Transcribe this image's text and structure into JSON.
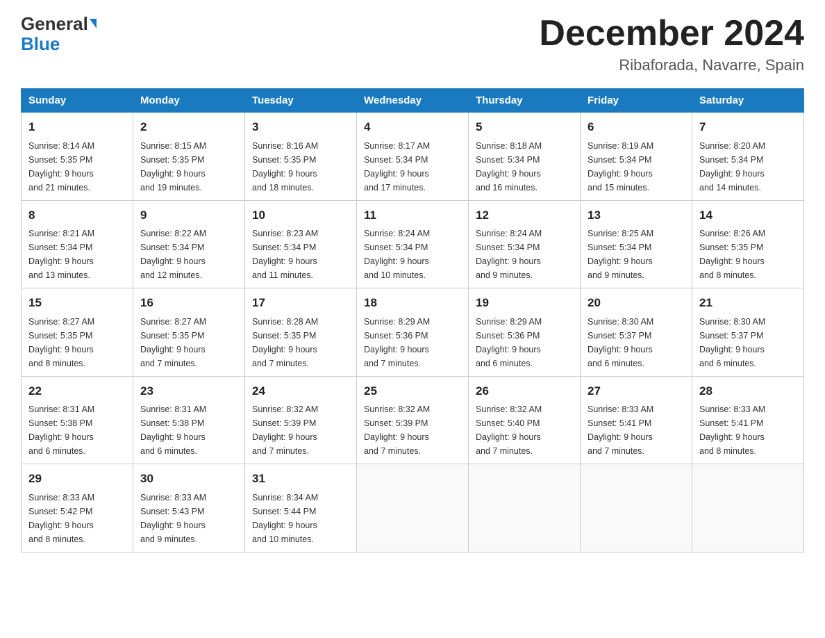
{
  "header": {
    "logo_general": "General",
    "logo_blue": "Blue",
    "month_title": "December 2024",
    "location": "Ribaforada, Navarre, Spain"
  },
  "days_of_week": [
    "Sunday",
    "Monday",
    "Tuesday",
    "Wednesday",
    "Thursday",
    "Friday",
    "Saturday"
  ],
  "weeks": [
    [
      {
        "num": "1",
        "info": "Sunrise: 8:14 AM\nSunset: 5:35 PM\nDaylight: 9 hours\nand 21 minutes."
      },
      {
        "num": "2",
        "info": "Sunrise: 8:15 AM\nSunset: 5:35 PM\nDaylight: 9 hours\nand 19 minutes."
      },
      {
        "num": "3",
        "info": "Sunrise: 8:16 AM\nSunset: 5:35 PM\nDaylight: 9 hours\nand 18 minutes."
      },
      {
        "num": "4",
        "info": "Sunrise: 8:17 AM\nSunset: 5:34 PM\nDaylight: 9 hours\nand 17 minutes."
      },
      {
        "num": "5",
        "info": "Sunrise: 8:18 AM\nSunset: 5:34 PM\nDaylight: 9 hours\nand 16 minutes."
      },
      {
        "num": "6",
        "info": "Sunrise: 8:19 AM\nSunset: 5:34 PM\nDaylight: 9 hours\nand 15 minutes."
      },
      {
        "num": "7",
        "info": "Sunrise: 8:20 AM\nSunset: 5:34 PM\nDaylight: 9 hours\nand 14 minutes."
      }
    ],
    [
      {
        "num": "8",
        "info": "Sunrise: 8:21 AM\nSunset: 5:34 PM\nDaylight: 9 hours\nand 13 minutes."
      },
      {
        "num": "9",
        "info": "Sunrise: 8:22 AM\nSunset: 5:34 PM\nDaylight: 9 hours\nand 12 minutes."
      },
      {
        "num": "10",
        "info": "Sunrise: 8:23 AM\nSunset: 5:34 PM\nDaylight: 9 hours\nand 11 minutes."
      },
      {
        "num": "11",
        "info": "Sunrise: 8:24 AM\nSunset: 5:34 PM\nDaylight: 9 hours\nand 10 minutes."
      },
      {
        "num": "12",
        "info": "Sunrise: 8:24 AM\nSunset: 5:34 PM\nDaylight: 9 hours\nand 9 minutes."
      },
      {
        "num": "13",
        "info": "Sunrise: 8:25 AM\nSunset: 5:34 PM\nDaylight: 9 hours\nand 9 minutes."
      },
      {
        "num": "14",
        "info": "Sunrise: 8:26 AM\nSunset: 5:35 PM\nDaylight: 9 hours\nand 8 minutes."
      }
    ],
    [
      {
        "num": "15",
        "info": "Sunrise: 8:27 AM\nSunset: 5:35 PM\nDaylight: 9 hours\nand 8 minutes."
      },
      {
        "num": "16",
        "info": "Sunrise: 8:27 AM\nSunset: 5:35 PM\nDaylight: 9 hours\nand 7 minutes."
      },
      {
        "num": "17",
        "info": "Sunrise: 8:28 AM\nSunset: 5:35 PM\nDaylight: 9 hours\nand 7 minutes."
      },
      {
        "num": "18",
        "info": "Sunrise: 8:29 AM\nSunset: 5:36 PM\nDaylight: 9 hours\nand 7 minutes."
      },
      {
        "num": "19",
        "info": "Sunrise: 8:29 AM\nSunset: 5:36 PM\nDaylight: 9 hours\nand 6 minutes."
      },
      {
        "num": "20",
        "info": "Sunrise: 8:30 AM\nSunset: 5:37 PM\nDaylight: 9 hours\nand 6 minutes."
      },
      {
        "num": "21",
        "info": "Sunrise: 8:30 AM\nSunset: 5:37 PM\nDaylight: 9 hours\nand 6 minutes."
      }
    ],
    [
      {
        "num": "22",
        "info": "Sunrise: 8:31 AM\nSunset: 5:38 PM\nDaylight: 9 hours\nand 6 minutes."
      },
      {
        "num": "23",
        "info": "Sunrise: 8:31 AM\nSunset: 5:38 PM\nDaylight: 9 hours\nand 6 minutes."
      },
      {
        "num": "24",
        "info": "Sunrise: 8:32 AM\nSunset: 5:39 PM\nDaylight: 9 hours\nand 7 minutes."
      },
      {
        "num": "25",
        "info": "Sunrise: 8:32 AM\nSunset: 5:39 PM\nDaylight: 9 hours\nand 7 minutes."
      },
      {
        "num": "26",
        "info": "Sunrise: 8:32 AM\nSunset: 5:40 PM\nDaylight: 9 hours\nand 7 minutes."
      },
      {
        "num": "27",
        "info": "Sunrise: 8:33 AM\nSunset: 5:41 PM\nDaylight: 9 hours\nand 7 minutes."
      },
      {
        "num": "28",
        "info": "Sunrise: 8:33 AM\nSunset: 5:41 PM\nDaylight: 9 hours\nand 8 minutes."
      }
    ],
    [
      {
        "num": "29",
        "info": "Sunrise: 8:33 AM\nSunset: 5:42 PM\nDaylight: 9 hours\nand 8 minutes."
      },
      {
        "num": "30",
        "info": "Sunrise: 8:33 AM\nSunset: 5:43 PM\nDaylight: 9 hours\nand 9 minutes."
      },
      {
        "num": "31",
        "info": "Sunrise: 8:34 AM\nSunset: 5:44 PM\nDaylight: 9 hours\nand 10 minutes."
      },
      null,
      null,
      null,
      null
    ]
  ]
}
